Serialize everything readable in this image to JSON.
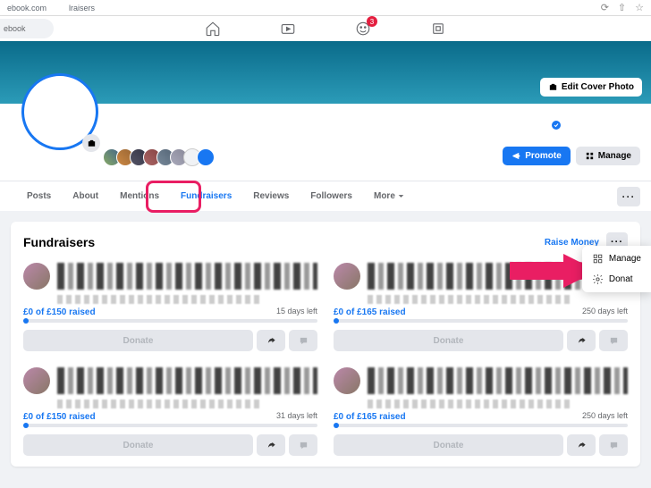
{
  "browser": {
    "url_left": "ebook.com",
    "url_right": "lraisers"
  },
  "header": {
    "search_placeholder": "ebook",
    "notification_count": "3"
  },
  "cover": {
    "edit_label": "Edit Cover Photo"
  },
  "actions": {
    "promote": "Promote",
    "manage": "Manage"
  },
  "tabs": {
    "items": [
      "Posts",
      "About",
      "Mentions",
      "Fundraisers",
      "Reviews",
      "Followers",
      "More"
    ],
    "active_index": 3
  },
  "section": {
    "title": "Fundraisers",
    "raise": "Raise Money"
  },
  "popup": {
    "manage": "Manage",
    "donate": "Donat"
  },
  "fundraisers": [
    {
      "raised": "£0 of £150 raised",
      "days": "15 days left",
      "donate": "Donate"
    },
    {
      "raised": "£0 of £165 raised",
      "days": "250 days left",
      "donate": "Donate"
    },
    {
      "raised": "£0 of £150 raised",
      "days": "31 days left",
      "donate": "Donate"
    },
    {
      "raised": "£0 of £165 raised",
      "days": "250 days left",
      "donate": "Donate"
    }
  ]
}
